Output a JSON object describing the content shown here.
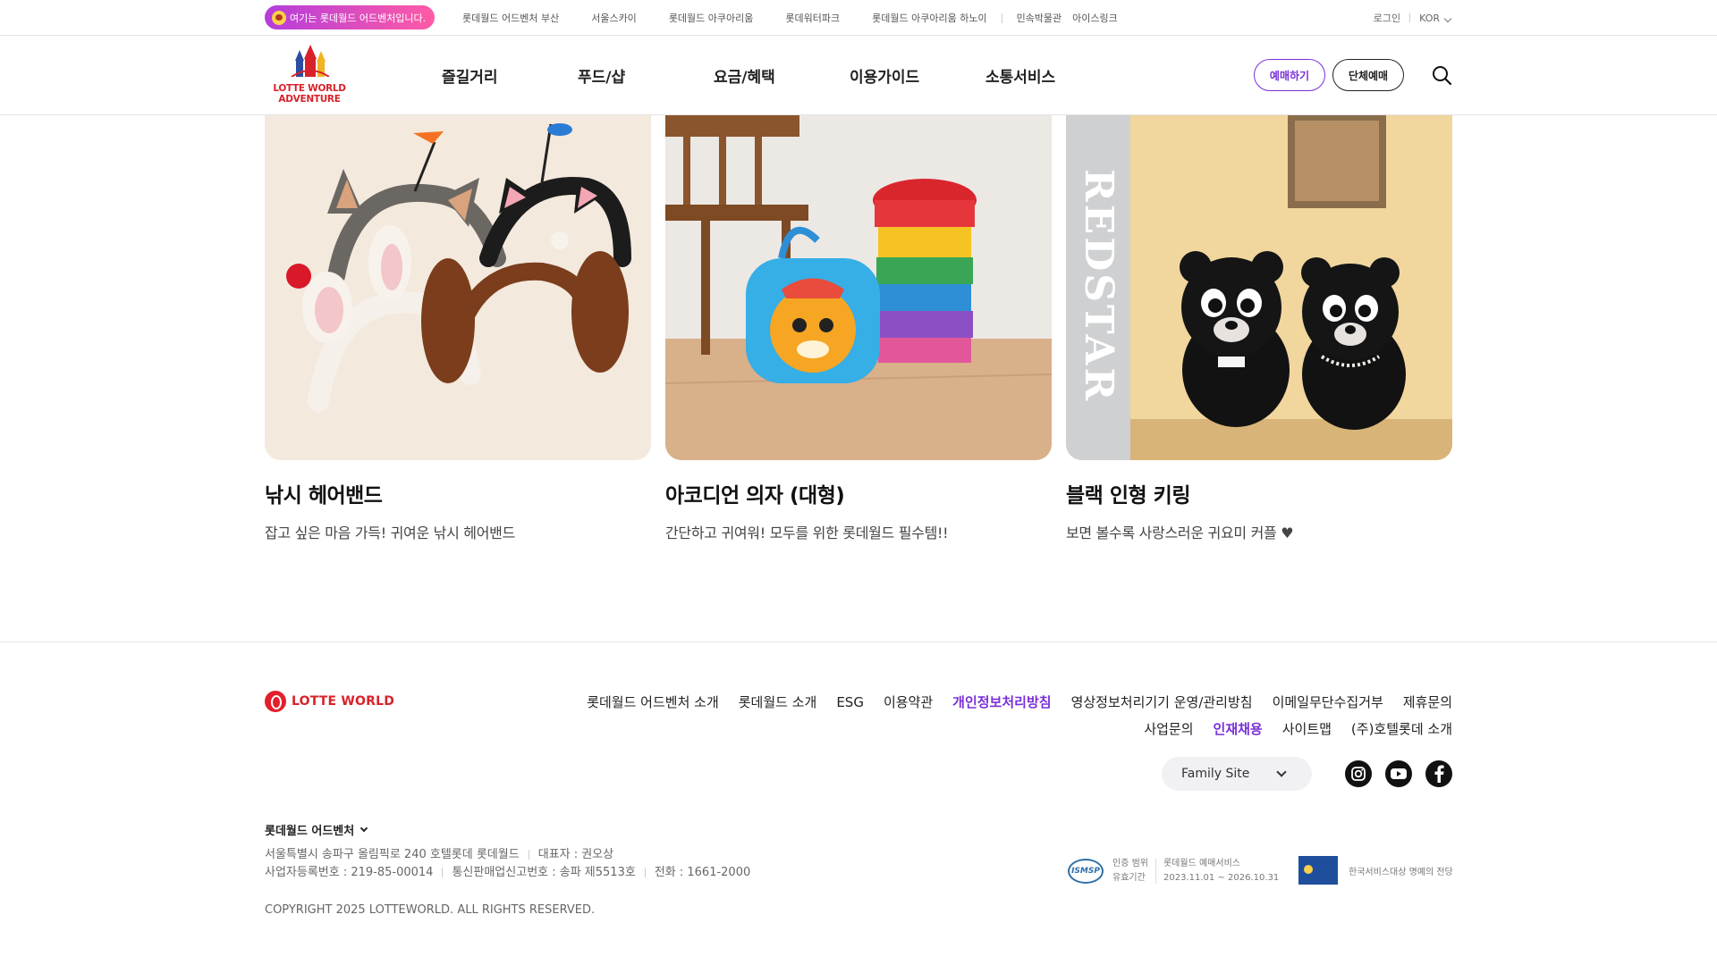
{
  "topbar": {
    "here_label": "여기는 롯데월드 어드벤처입니다.",
    "sites": [
      "롯데월드 어드벤처 부산",
      "서울스카이",
      "롯데월드 아쿠아리움",
      "롯데워터파크",
      "롯데월드 아쿠아리움 하노이",
      "민속박물관",
      "아이스링크"
    ],
    "login": "로그인",
    "language": "KOR"
  },
  "header": {
    "logo_line1": "LOTTE WORLD",
    "logo_line2": "ADVENTURE",
    "nav": [
      "즐길거리",
      "푸드/샵",
      "요금/혜택",
      "이용가이드",
      "소통서비스"
    ],
    "reserve_label": "예매하기",
    "group_label": "단체예매"
  },
  "products": [
    {
      "title": "낚시 헤어밴드",
      "desc": "잡고 싶은 마음 가득! 귀여운 낚시 헤어밴드"
    },
    {
      "title": "아코디언 의자 (대형)",
      "desc": "간단하고 귀여워! 모두를 위한 롯데월드 필수템!!"
    },
    {
      "title": "블랙 인형 키링",
      "desc": "보면 볼수록 사랑스러운 귀요미 커플 ♥",
      "photo_text": "REDSTAR"
    }
  ],
  "footer": {
    "logo_text": "LOTTE WORLD",
    "links_row1": [
      "롯데월드 어드벤처 소개",
      "롯데월드 소개",
      "ESG",
      "이용약관",
      "개인정보처리방침",
      "영상정보처리기기 운영/관리방침",
      "이메일무단수집거부",
      "제휴문의"
    ],
    "links_row2": [
      "사업문의",
      "인재채용",
      "사이트맵",
      "(주)호텔롯데 소개"
    ],
    "family_site": "Family Site",
    "company_select": "롯데월드 어드벤처",
    "address": "서울특별시 송파구 올림픽로 240 호텔롯데 롯데월드",
    "ceo": "대표자 : 권오상",
    "biz_no": "사업자등록번호 : 219-85-00014",
    "mail_order": "통신판매업신고번호 : 송파 제5513호",
    "phone": "전화 : 1661-2000",
    "copyright": "COPYRIGHT 2025 LOTTEWORLD. ALL RIGHTS RESERVED.",
    "isms_badge": "ISMSP",
    "isms_label1": "인증 범위",
    "isms_label2": "유효기간",
    "isms_value1": "롯데월드 예매서비스",
    "isms_value2": "2023.11.01 ~ 2026.10.31",
    "kssa_text": "한국서비스대상 명예의 전당"
  },
  "colors": {
    "accent": "#7a2fd8",
    "brand_red": "#d8222b"
  }
}
